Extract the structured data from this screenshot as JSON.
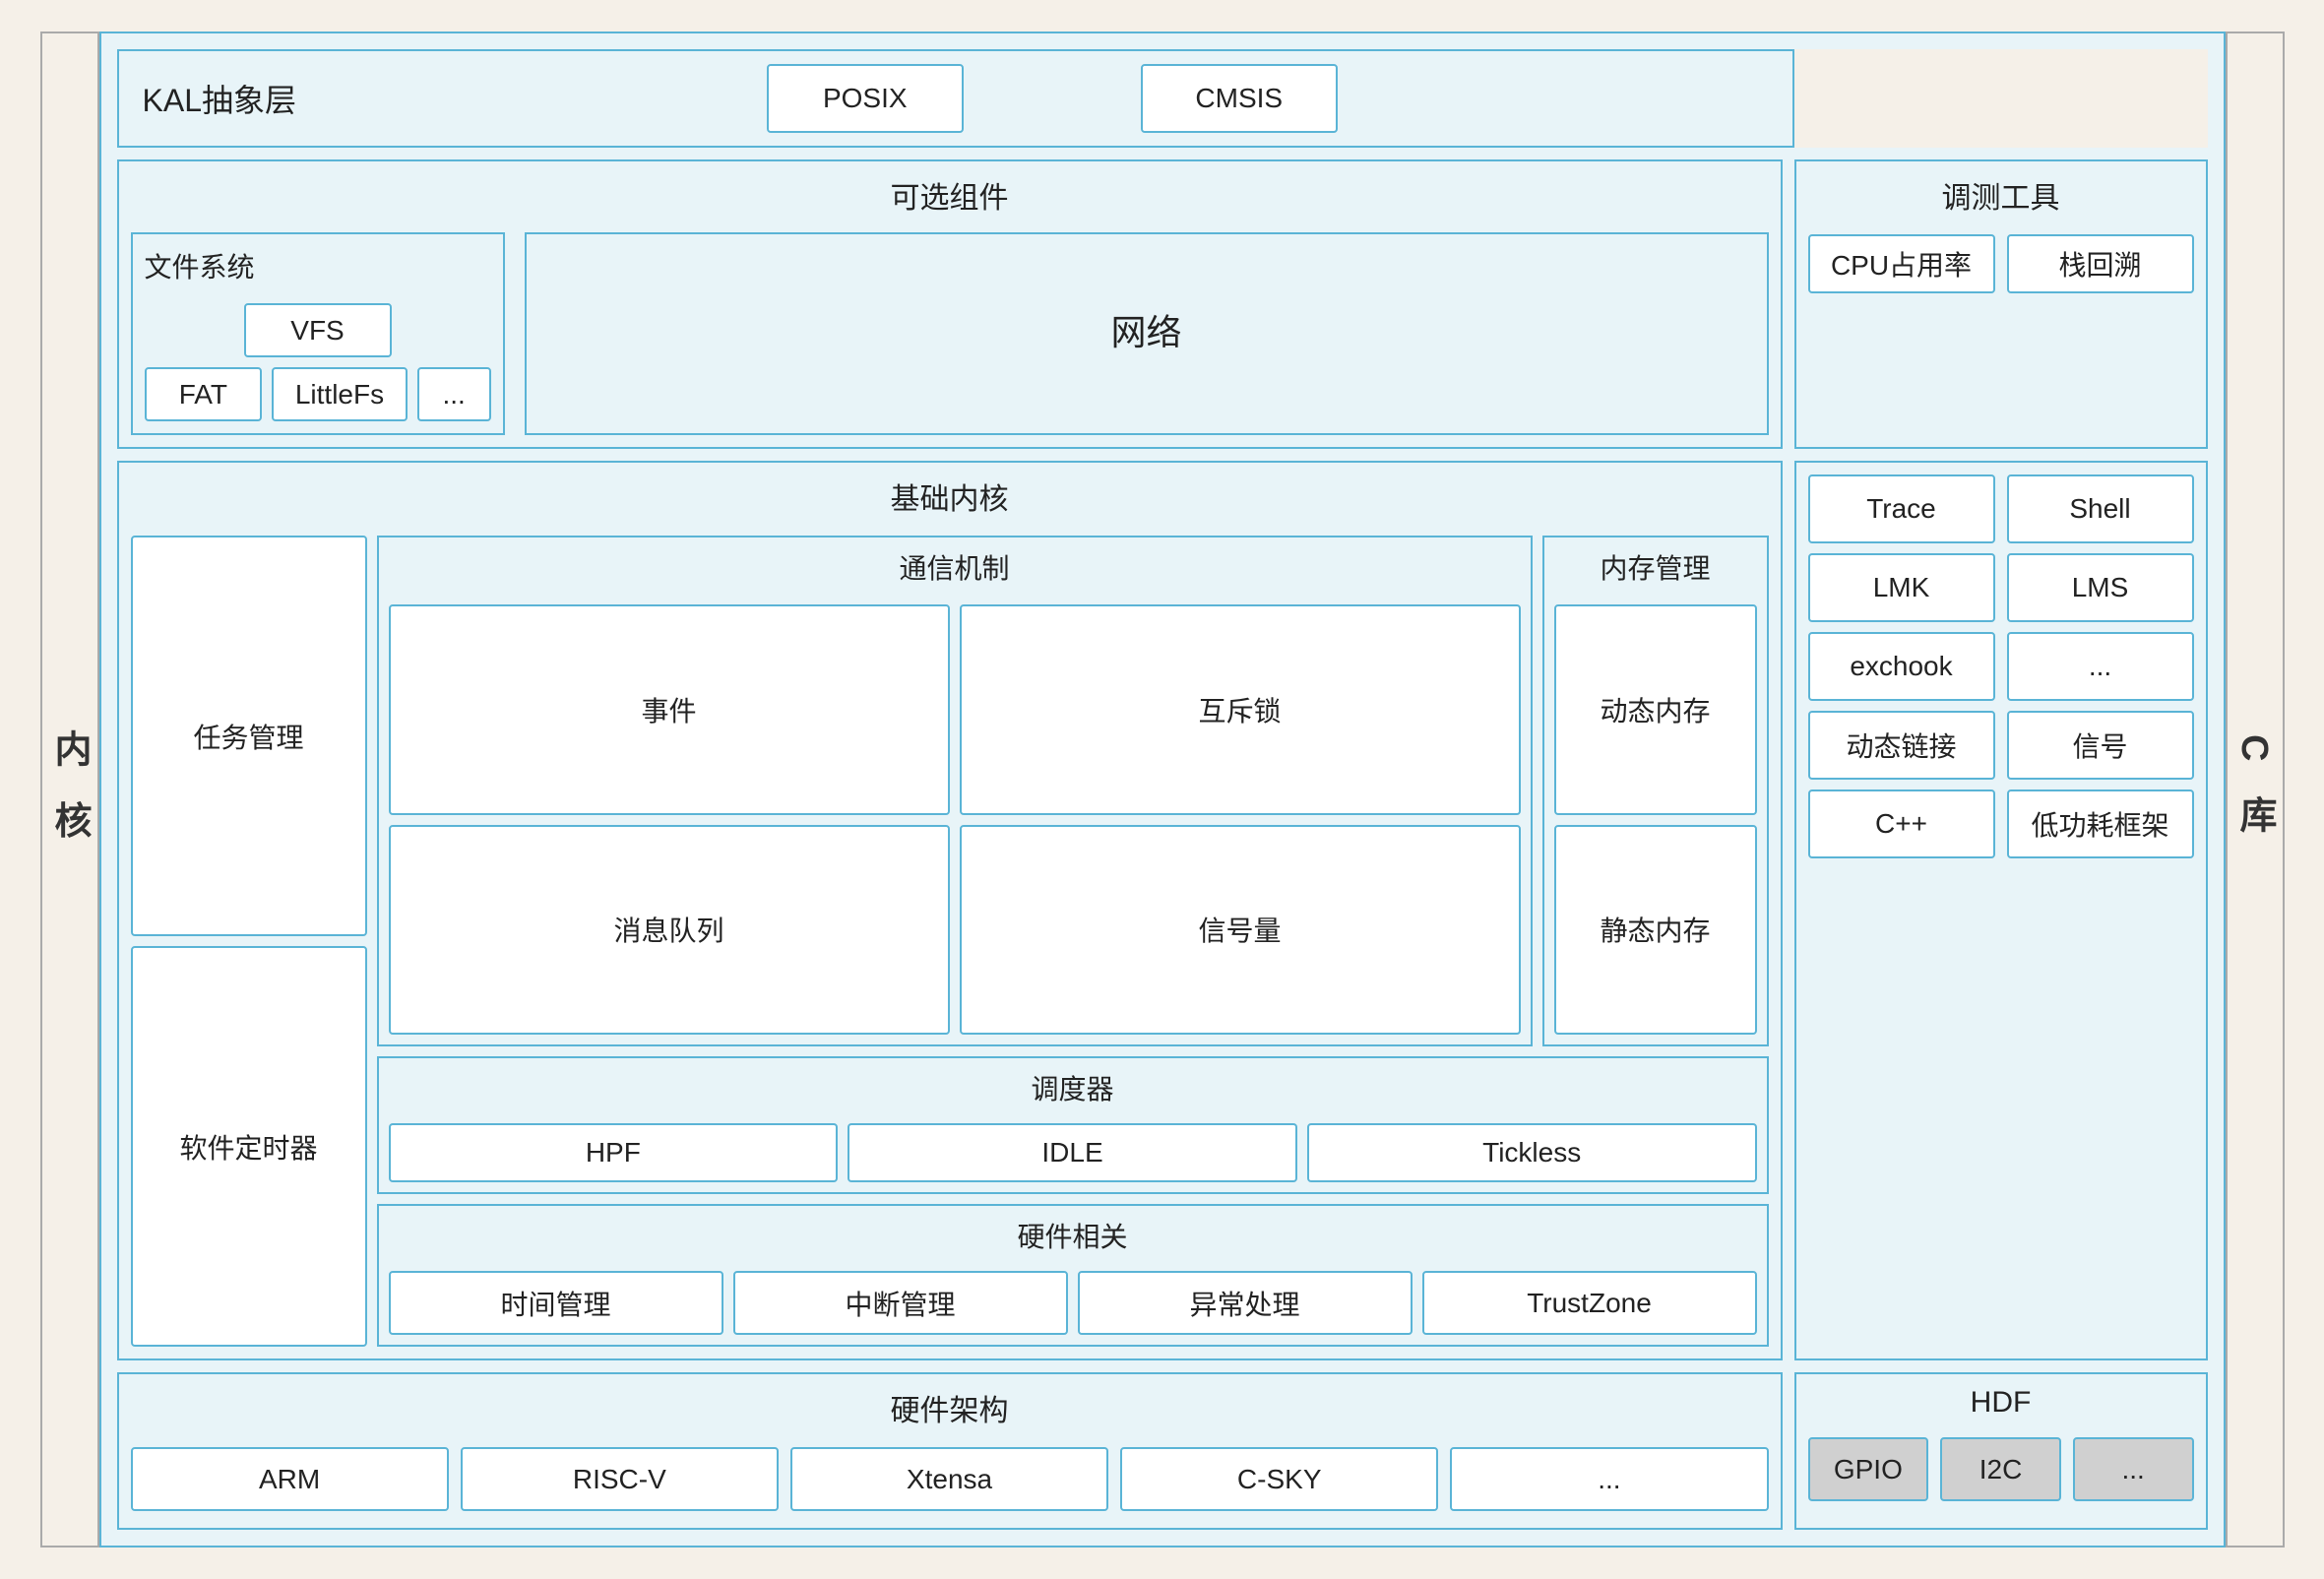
{
  "left_label": "内\n核",
  "right_label": "C\n库",
  "kal": {
    "title": "KAL抽象层",
    "posix": "POSIX",
    "cmsis": "CMSIS"
  },
  "optional": {
    "title": "可选组件",
    "filesystem": {
      "title": "文件系统",
      "vfs": "VFS",
      "fat": "FAT",
      "littlefs": "LittleFs",
      "etc": "..."
    },
    "network": "网络",
    "debug": {
      "title": "调测工具",
      "cpu": "CPU占用率",
      "stack": "栈回溯",
      "trace": "Trace",
      "shell": "Shell",
      "lmk": "LMK",
      "lms": "LMS",
      "exchook": "exchook",
      "etc": "...",
      "dynlink": "动态链接",
      "signal": "信号",
      "cpp": "C++",
      "lowpower": "低功耗框架"
    }
  },
  "core": {
    "title": "基础内核",
    "task": "任务管理",
    "timer": "软件定时器",
    "comm": {
      "title": "通信机制",
      "event": "事件",
      "mutex": "互斥锁",
      "msgqueue": "消息队列",
      "semaphore": "信号量"
    },
    "memory": {
      "title": "内存管理",
      "dynamic": "动态内存",
      "static": "静态内存"
    },
    "scheduler": {
      "title": "调度器",
      "hpf": "HPF",
      "idle": "IDLE",
      "tickless": "Tickless"
    },
    "hw_related": {
      "title": "硬件相关",
      "time": "时间管理",
      "interrupt": "中断管理",
      "exception": "异常处理",
      "trustzone": "TrustZone"
    }
  },
  "hw_arch": {
    "title": "硬件架构",
    "arm": "ARM",
    "riscv": "RISC-V",
    "xtensa": "Xtensa",
    "csky": "C-SKY",
    "etc": "..."
  },
  "hdf": {
    "title": "HDF",
    "gpio": "GPIO",
    "i2c": "I2C",
    "etc": "..."
  }
}
